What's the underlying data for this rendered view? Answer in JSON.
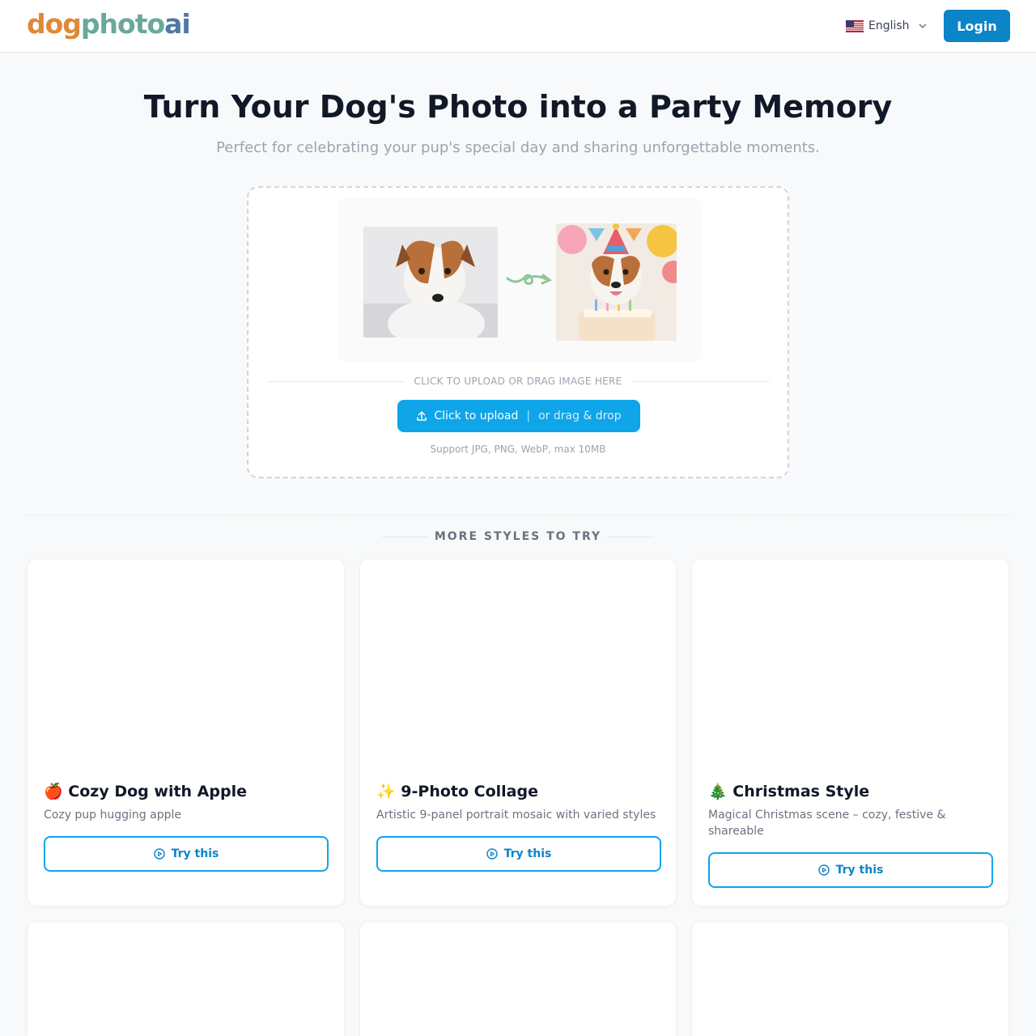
{
  "header": {
    "logo": {
      "part1": "dog",
      "part2": "photo",
      "part3": "ai"
    },
    "language": "English",
    "login_label": "Login"
  },
  "hero": {
    "title": "Turn Your Dog's Photo into a Party Memory",
    "subtitle": "Perfect for celebrating your pup's special day and sharing unforgettable moments."
  },
  "upload": {
    "divider_text": "CLICK TO UPLOAD OR DRAG IMAGE HERE",
    "button_primary": "Click to upload",
    "button_separator": "|",
    "button_secondary": "or drag & drop",
    "support_text": "Support JPG, PNG, WebP, max 10MB"
  },
  "styles_section": {
    "title": "MORE STYLES TO TRY",
    "cards": [
      {
        "emoji": "🍎",
        "title": "Cozy Dog with Apple",
        "description": "Cozy pup hugging apple",
        "button": "Try this"
      },
      {
        "emoji": "✨",
        "title": "9-Photo Collage",
        "description": "Artistic 9-panel portrait mosaic with varied styles",
        "button": "Try this"
      },
      {
        "emoji": "🎄",
        "title": "Christmas Style",
        "description": "Magical Christmas scene – cozy, festive & shareable",
        "button": "Try this"
      }
    ]
  },
  "colors": {
    "primary": "#0b84c8",
    "accent": "#0ea5e9",
    "logo_orange": "#e0883a",
    "logo_teal": "#6aa89a",
    "logo_blue": "#4f79a4"
  }
}
